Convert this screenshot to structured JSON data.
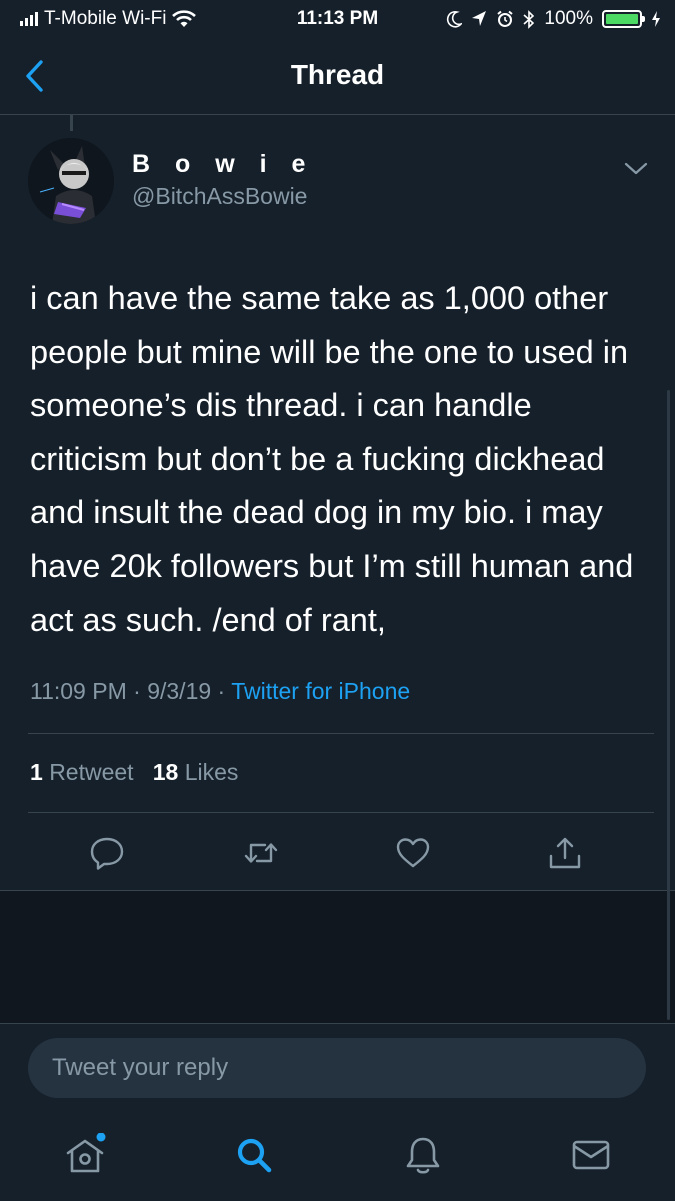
{
  "status_bar": {
    "carrier": "T-Mobile Wi-Fi",
    "time": "11:13 PM",
    "battery": "100%",
    "battery_color": "#4cd964"
  },
  "header": {
    "title": "Thread",
    "back_icon": "chevron-left-icon"
  },
  "tweet": {
    "display_name": "B o w i e",
    "handle": "@BitchAssBowie",
    "text": "i can have the same take as 1,000 other people but mine will be the one to used in someone’s dis thread. i can handle criticism but don’t be a fucking dickhead and insult the dead dog in my bio. i may have 20k followers but I’m still human and act as such. /end of rant,",
    "time": "11:09 PM",
    "separator": "·",
    "date": "9/3/19",
    "source": "Twitter for iPhone",
    "retweet_count": "1",
    "retweet_label": "Retweet",
    "like_count": "18",
    "like_label": "Likes"
  },
  "reply": {
    "placeholder": "Tweet your reply"
  },
  "tabs": [
    "home-icon",
    "search-icon",
    "notifications-icon",
    "messages-icon"
  ],
  "colors": {
    "background": "#15202b",
    "accent": "#1da1f2",
    "secondary_text": "#8899a6",
    "divider": "#38444d"
  }
}
